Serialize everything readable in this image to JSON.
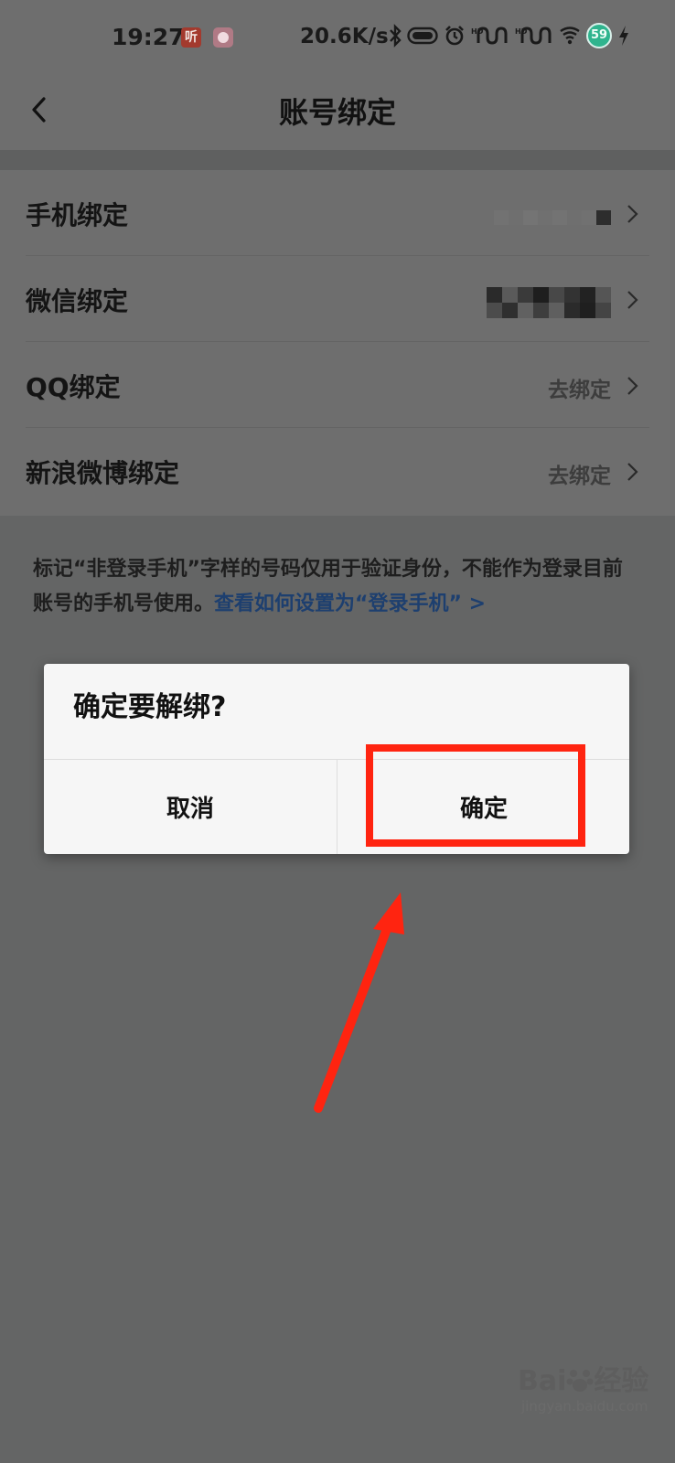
{
  "status_bar": {
    "time": "19:27",
    "app_icon_text": "听",
    "network_speed": "20.6K/s",
    "battery": "59",
    "icons": [
      "bluetooth-icon",
      "toggle-icon",
      "alarm-icon",
      "signal-hd1-icon",
      "signal-hd2-icon",
      "wifi-icon",
      "charging-icon"
    ]
  },
  "header": {
    "title": "账号绑定"
  },
  "bindings": [
    {
      "label": "手机绑定",
      "value": ""
    },
    {
      "label": "微信绑定",
      "value": ""
    },
    {
      "label": "QQ绑定",
      "value": "去绑定"
    },
    {
      "label": "新浪微博绑定",
      "value": "去绑定"
    }
  ],
  "note": {
    "text": "标记“非登录手机”字样的号码仅用于验证身份，不能作为登录目前账号的手机号使用。",
    "link": "查看如何设置为“登录手机” >"
  },
  "dialog": {
    "title": "确定要解绑?",
    "cancel_label": "取消",
    "confirm_label": "确定"
  },
  "watermark": {
    "brand_prefix": "Bai",
    "brand_suffix": "经验",
    "url": "jingyan.baidu.com"
  },
  "colors": {
    "overlay": "#646565",
    "highlight": "#ff2410",
    "link": "#1d3f6f",
    "dialog_bg": "#f6f6f6"
  }
}
